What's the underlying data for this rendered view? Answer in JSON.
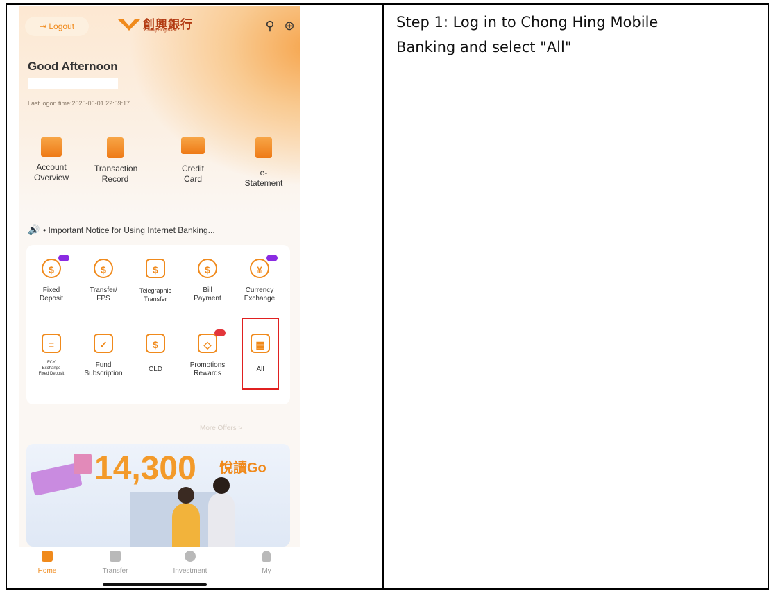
{
  "instruction": {
    "line1": "Step 1: Log in to Chong Hing Mobile",
    "line2": "Banking and select \"All\""
  },
  "app": {
    "logout_label": "Logout",
    "bank_name_cn": "創興銀行",
    "bank_name_en": "Chong Hing Bank",
    "greeting": "Good Afternoon",
    "last_logon": "Last logon time:2025-06-01 22:59:17",
    "quick_actions": [
      {
        "line1": "Account",
        "line2": "Overview"
      },
      {
        "line1": "Transaction",
        "line2": "Record"
      },
      {
        "line1": "Credit Card",
        "line2": ""
      },
      {
        "line1": "e-Statement",
        "line2": ""
      }
    ],
    "notice": "• Important Notice for Using Internet Banking...",
    "services_row1": [
      {
        "line1": "Fixed",
        "line2": "Deposit",
        "glyph": "$"
      },
      {
        "line1": "Transfer/",
        "line2": "FPS",
        "glyph": "$"
      },
      {
        "line1": "Telegraphic",
        "line2": "Transfer",
        "glyph": "$"
      },
      {
        "line1": "Bill",
        "line2": "Payment",
        "glyph": "$"
      },
      {
        "line1": "Currency",
        "line2": "Exchange",
        "glyph": "¥"
      }
    ],
    "services_row2": [
      {
        "line1": "FCY",
        "line2": "Exchange",
        "line3": "Fixed Deposit",
        "glyph": "≡"
      },
      {
        "line1": "Fund",
        "line2": "Subscription",
        "glyph": "✓"
      },
      {
        "line1": "CLD",
        "line2": "",
        "glyph": "$"
      },
      {
        "line1": "Promotions",
        "line2": "Rewards",
        "glyph": "◇"
      },
      {
        "line1": "All",
        "line2": "",
        "glyph": "▦"
      }
    ],
    "more_offers": "More Offers >",
    "promo": {
      "amount": "14,300",
      "brand": "悅讀Go"
    },
    "tabs": [
      "Home",
      "Transfer",
      "Investment",
      "My"
    ]
  }
}
